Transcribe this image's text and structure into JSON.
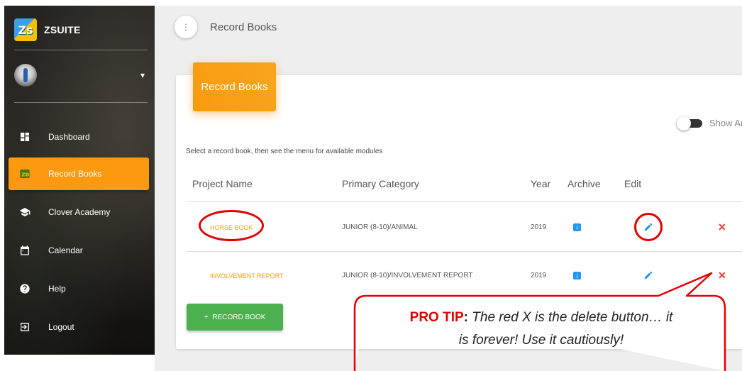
{
  "sidebar": {
    "brand": {
      "logo_text": "Zs",
      "name": "ZSUITE"
    },
    "user": {
      "caret": "▾"
    },
    "items": [
      {
        "label": "Dashboard",
        "icon": "dashboard-icon",
        "active": false
      },
      {
        "label": "Record Books",
        "icon": "record-books-icon",
        "active": true
      },
      {
        "label": "Clover Academy",
        "icon": "graduation-cap-icon",
        "active": false
      },
      {
        "label": "Calendar",
        "icon": "calendar-icon",
        "active": false
      },
      {
        "label": "Help",
        "icon": "help-icon",
        "active": false
      },
      {
        "label": "Logout",
        "icon": "logout-icon",
        "active": false
      }
    ]
  },
  "topbar": {
    "menu_glyph": "⋮",
    "title": "Record Books"
  },
  "card": {
    "header": "Record Books",
    "toggle_label": "Show Ar",
    "hint": "Select a record book, then see the menu for available modules",
    "columns": [
      "Project Name",
      "Primary Category",
      "Year",
      "Archive",
      "Edit"
    ],
    "rows": [
      {
        "project": "HORSE BOOK",
        "category": "JUNIOR (8-10)/ANIMAL",
        "year": "2019"
      },
      {
        "project": "INVOLVEMENT REPORT",
        "category": "JUNIOR (8-10)/INVOLVEMENT REPORT",
        "year": "2019"
      }
    ],
    "add_button": {
      "icon": "+",
      "label": "RECORD BOOK"
    },
    "archive_glyph": "↓",
    "delete_glyph": "✕"
  },
  "callout": {
    "label": "PRO TIP",
    "colon": ":",
    "text_line1": " The red X is the delete button… it",
    "text_line2": "is forever! Use it cautiously!"
  },
  "colors": {
    "accent": "#fb9a0f",
    "add_button": "#4caf50",
    "edit_icon": "#2196f3",
    "delete": "#e53935",
    "annotation_red": "#e00000"
  }
}
